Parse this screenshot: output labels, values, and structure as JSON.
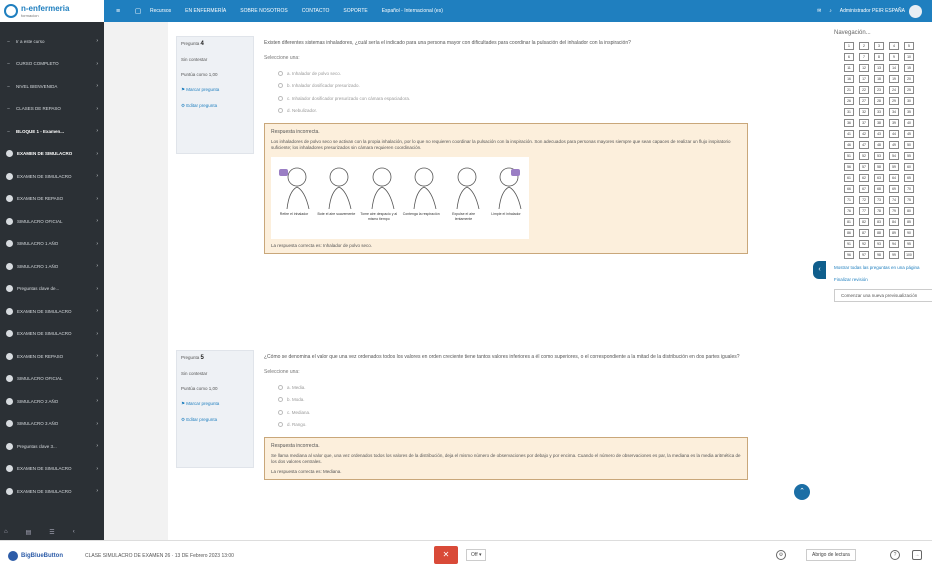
{
  "brand": {
    "name": "n-enfermeria",
    "sub": "formacion"
  },
  "topnav": [
    "Recursos",
    "EN ENFERMERÍA",
    "SOBRE NOSOTROS",
    "CONTACTO",
    "SOPORTE",
    "Español - Internacional (es)"
  ],
  "user": {
    "name": "Administrador PEIR ESPAÑA"
  },
  "sidebar": {
    "items": [
      {
        "label": "Ir a este curso",
        "type": "dash",
        "bold": false
      },
      {
        "label": "CURSO COMPLETO",
        "type": "dash",
        "bold": false
      },
      {
        "label": "NIVEL BIENVENIDA",
        "type": "dash",
        "bold": false
      },
      {
        "label": "CLASES DE REPASO",
        "type": "dash",
        "bold": false
      },
      {
        "label": "BLOQUE 1 - Examen...",
        "type": "dash",
        "bold": true
      },
      {
        "label": "EXAMEN DE SIMULACRO",
        "type": "dot",
        "bold": true
      },
      {
        "label": "EXAMEN DE SIMULACRO",
        "type": "dot",
        "bold": false
      },
      {
        "label": "EXAMEN DE REPASO",
        "type": "dot",
        "bold": false
      },
      {
        "label": "SIMULACRO OFICIAL",
        "type": "dot",
        "bold": false
      },
      {
        "label": "SIMULACRO 1 AÑO",
        "type": "dot",
        "bold": false
      },
      {
        "label": "SIMULACRO 1 AÑO",
        "type": "dot",
        "bold": false
      },
      {
        "label": "Preguntas clave de...",
        "type": "dot",
        "bold": false
      },
      {
        "label": "EXAMEN DE SIMULACRO",
        "type": "dot",
        "bold": false
      },
      {
        "label": "EXAMEN DE SIMULACRO",
        "type": "dot",
        "bold": false
      },
      {
        "label": "EXAMEN DE REPASO",
        "type": "dot",
        "bold": false
      },
      {
        "label": "SIMULACRO OFICIAL",
        "type": "dot",
        "bold": false
      },
      {
        "label": "SIMULACRO 2 AÑO",
        "type": "dot",
        "bold": false
      },
      {
        "label": "SIMULACRO 3 AÑO",
        "type": "dot",
        "bold": false
      },
      {
        "label": "Preguntas clave 3...",
        "type": "dot",
        "bold": false
      },
      {
        "label": "EXAMEN DE SIMULACRO",
        "type": "dot",
        "bold": false
      },
      {
        "label": "EXAMEN DE SIMULACRO",
        "type": "dot",
        "bold": false
      }
    ]
  },
  "q1": {
    "num_label": "Pregunta",
    "num": "4",
    "status": "Sin contestar",
    "score": "Puntúa como 1,00",
    "flag": "Marcar pregunta",
    "edit": "Editar pregunta",
    "text": "Existen diferentes sistemas inhaladores, ¿cuál sería el indicado para una persona mayor con dificultades para coordinar la pulsación del inhalador con la inspiración?",
    "select_label": "Seleccione una:",
    "options": [
      "a. Inhalador de polvo seco.",
      "b. Inhalador dosificador presurizado.",
      "c. Inhalador dosificador presurizado con cámara espaciadora.",
      "d. Nebulizador."
    ],
    "feedback_title": "Respuesta incorrecta.",
    "feedback_text": "Los inhaladores de polvo seco se activan con la propia inhalación, por lo que no requieren coordinar la pulsación con la inspiración. Son adecuados para personas mayores siempre que sean capaces de realizar un flujo inspiratorio suficiente; los inhaladores presurizados sin cámara requieren coordinación.",
    "figure_captions": [
      "Retire el inhalador",
      "Bote el aire suavemente",
      "Tome aire despacio y al mismo tiempo",
      "Contenga la respiración",
      "Expulse el aire lentamente",
      "Limpie el inhalador"
    ],
    "answer": "La respuesta correcta es: Inhalador de polvo seco."
  },
  "q2": {
    "num_label": "Pregunta",
    "num": "5",
    "status": "Sin contestar",
    "score": "Puntúa como 1,00",
    "flag": "Marcar pregunta",
    "edit": "Editar pregunta",
    "text": "¿Cómo se denomina el valor que una vez ordenados todos los valores en orden creciente tiene tantos valores inferiores a él como superiores, o el correspondiente a la mitad de la distribución en dos partes iguales?",
    "select_label": "Seleccione una:",
    "options": [
      "a. Media.",
      "b. Moda.",
      "c. Mediana.",
      "d. Rango."
    ],
    "feedback_title": "Respuesta incorrecta.",
    "feedback_text": "Se llama mediana al valor que, una vez ordenados todos los valores de la distribución, deja el mismo número de observaciones por debajo y por encima. Cuando el número de observaciones es par, la mediana es la media aritmética de los dos valores centrales.",
    "answer": "La respuesta correcta es: Mediana."
  },
  "nav": {
    "title": "Navegación...",
    "questions": [
      "1",
      "2",
      "3",
      "4",
      "5",
      "6",
      "7",
      "8",
      "9",
      "10",
      "11",
      "12",
      "13",
      "14",
      "15",
      "16",
      "17",
      "18",
      "19",
      "20",
      "21",
      "22",
      "23",
      "24",
      "25",
      "26",
      "27",
      "28",
      "29",
      "30",
      "31",
      "32",
      "33",
      "34",
      "35",
      "36",
      "37",
      "38",
      "39",
      "40",
      "41",
      "42",
      "43",
      "44",
      "45",
      "46",
      "47",
      "48",
      "49",
      "50",
      "51",
      "52",
      "53",
      "54",
      "55",
      "56",
      "57",
      "58",
      "59",
      "60",
      "61",
      "62",
      "63",
      "64",
      "65",
      "66",
      "67",
      "68",
      "69",
      "70",
      "71",
      "72",
      "73",
      "74",
      "75",
      "76",
      "77",
      "78",
      "79",
      "80",
      "81",
      "82",
      "83",
      "84",
      "85",
      "86",
      "87",
      "88",
      "89",
      "90",
      "91",
      "92",
      "93",
      "94",
      "95",
      "96",
      "97",
      "98",
      "99",
      "100"
    ],
    "link1": "Mostrar todas las preguntas en una página",
    "link2": "Finalizar revisión",
    "button": "Comenzar una nueva previsualización"
  },
  "bottom": {
    "app": "BigBlueButton",
    "meeting": "CLASE SIMULACRO DE EXAMEN 26 · 13 DE Febrero 2023 13:00",
    "audio": "Off",
    "leave": "Abrigo de lectura"
  },
  "colors": {
    "topbar": "#1f7fbf",
    "sidebar": "#2b3035",
    "feedback_bg": "#fcefdc",
    "feedback_border": "#c9a77a",
    "mic": "#d94a38"
  }
}
